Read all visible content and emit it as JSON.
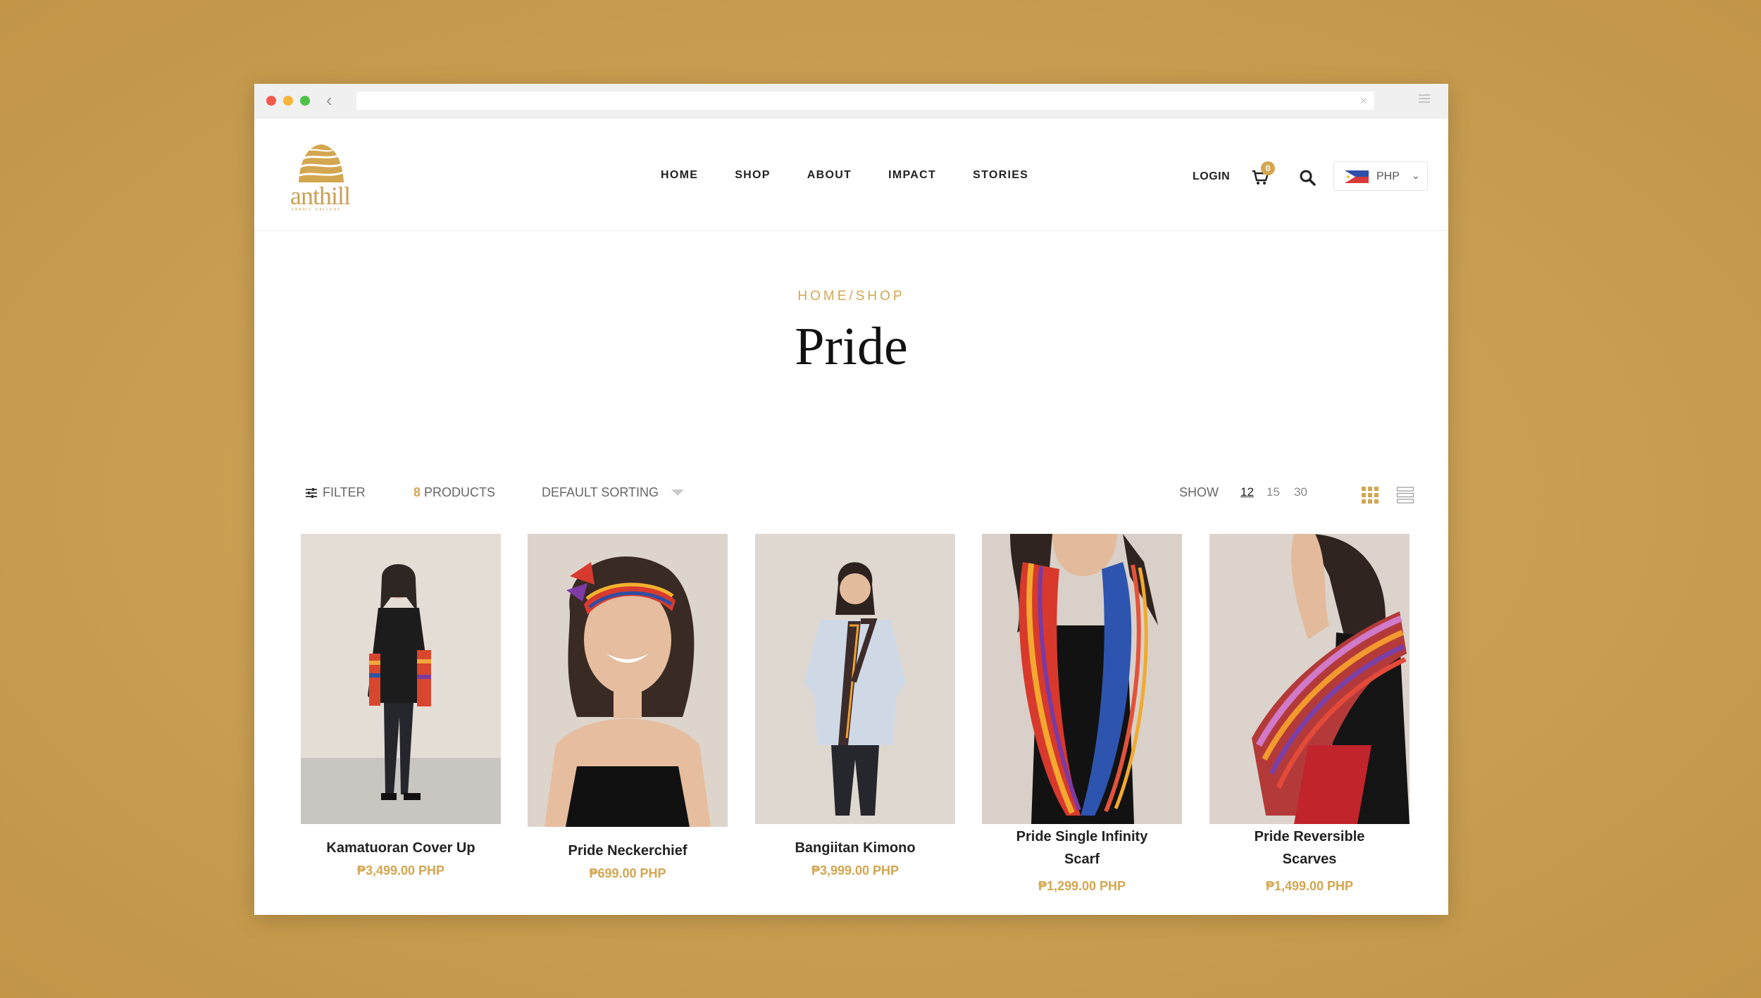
{
  "browser": {
    "url": ""
  },
  "brand": {
    "name": "anthill",
    "tagline": "FABRIC GALLERY"
  },
  "nav": {
    "items": [
      "HOME",
      "SHOP",
      "ABOUT",
      "IMPACT",
      "STORIES"
    ]
  },
  "header": {
    "login": "LOGIN",
    "cart_count": "0",
    "currency": "PHP"
  },
  "breadcrumb": {
    "home": "HOME",
    "separator": "/",
    "shop": "SHOP"
  },
  "page": {
    "title": "Pride"
  },
  "toolbar": {
    "filter": "FILTER",
    "product_count": "8",
    "product_label": "PRODUCTS",
    "sorting": "DEFAULT SORTING",
    "show_label": "SHOW",
    "per_page": [
      "12",
      "15",
      "30"
    ],
    "active_per_page": "12"
  },
  "products": [
    {
      "name": "Kamatuoran Cover Up",
      "price": "₱3,499.00 PHP"
    },
    {
      "name": "Pride Neckerchief",
      "price": "₱699.00 PHP"
    },
    {
      "name": "Bangiitan Kimono",
      "price": "₱3,999.00 PHP"
    },
    {
      "name": "Pride Single Infinity",
      "name2": "Scarf",
      "price": "₱1,299.00 PHP"
    },
    {
      "name": "Pride Reversible",
      "name2": "Scarves",
      "price": "₱1,499.00 PHP"
    }
  ],
  "colors": {
    "accent": "#d3a650",
    "background": "#c99f52"
  }
}
